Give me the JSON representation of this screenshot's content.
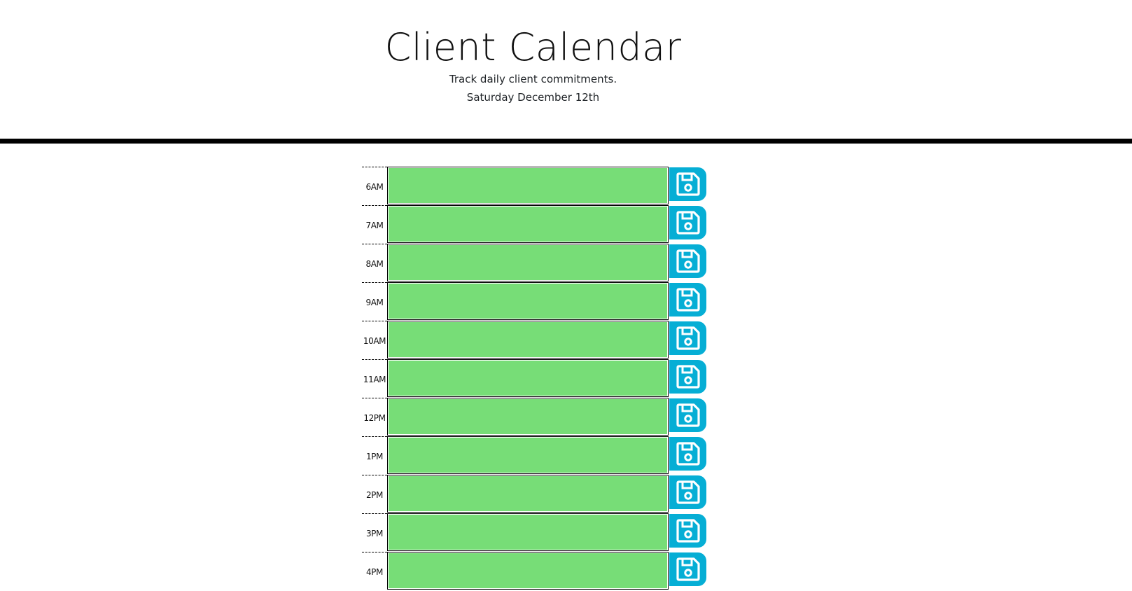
{
  "header": {
    "title": "Client Calendar",
    "subtitle": "Track daily client commitments.",
    "current_day": "Saturday December 12th"
  },
  "colors": {
    "present_or_future_block": "#77dd77",
    "save_button": "#06aed5",
    "divider": "#000000"
  },
  "save_icon": "floppy-disk-icon",
  "time_blocks": [
    {
      "hour": "6AM",
      "text": ""
    },
    {
      "hour": "7AM",
      "text": ""
    },
    {
      "hour": "8AM",
      "text": ""
    },
    {
      "hour": "9AM",
      "text": ""
    },
    {
      "hour": "10AM",
      "text": ""
    },
    {
      "hour": "11AM",
      "text": ""
    },
    {
      "hour": "12PM",
      "text": ""
    },
    {
      "hour": "1PM",
      "text": ""
    },
    {
      "hour": "2PM",
      "text": ""
    },
    {
      "hour": "3PM",
      "text": ""
    },
    {
      "hour": "4PM",
      "text": ""
    }
  ]
}
